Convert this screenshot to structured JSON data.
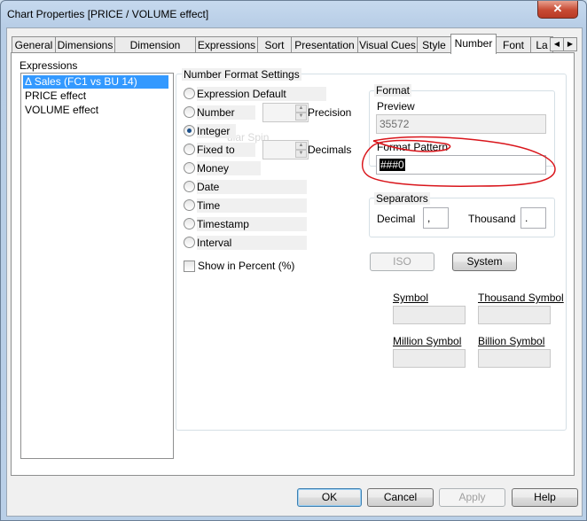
{
  "window": {
    "title": "Chart Properties [PRICE / VOLUME effect]",
    "close_glyph": "✕"
  },
  "tabs": [
    "General",
    "Dimensions",
    "Dimension Limits",
    "Expressions",
    "Sort",
    "Presentation",
    "Visual Cues",
    "Style",
    "Number",
    "Font",
    "La"
  ],
  "active_tab": "Number",
  "tab_scroll": {
    "left": "◀",
    "right": "▶"
  },
  "expressions": {
    "label": "Expressions",
    "items": [
      "Δ  Sales (FC1 vs BU 14)",
      "PRICE effect",
      "VOLUME effect"
    ],
    "selected_index": 0
  },
  "number_format": {
    "group_label": "Number Format Settings",
    "options": [
      "Expression Default",
      "Number",
      "Integer",
      "Fixed to",
      "Money",
      "Date",
      "Time",
      "Timestamp",
      "Interval"
    ],
    "selected": "Integer",
    "precision_label": "Precision",
    "decimals_label": "Decimals",
    "show_in_percent_label": "Show in Percent (%)",
    "show_in_percent_checked": false,
    "ghost_text": "ular Spin"
  },
  "format": {
    "group_label": "Format",
    "preview_label": "Preview",
    "preview_value": "35572",
    "pattern_label": "Format Pattern",
    "pattern_value": "###0"
  },
  "separators": {
    "group_label": "Separators",
    "decimal_label": "Decimal",
    "decimal_value": ",",
    "thousand_label": "Thousand",
    "thousand_value": "."
  },
  "buttons": {
    "iso": "ISO",
    "system": "System",
    "ok": "OK",
    "cancel": "Cancel",
    "apply": "Apply",
    "help": "Help"
  },
  "symbols": {
    "symbol_label": "Symbol",
    "thousand_symbol_label": "Thousand Symbol",
    "million_symbol_label": "Million Symbol",
    "billion_symbol_label": "Billion Symbol"
  },
  "colors": {
    "selection": "#3399ff",
    "annotation": "#d9151b"
  }
}
